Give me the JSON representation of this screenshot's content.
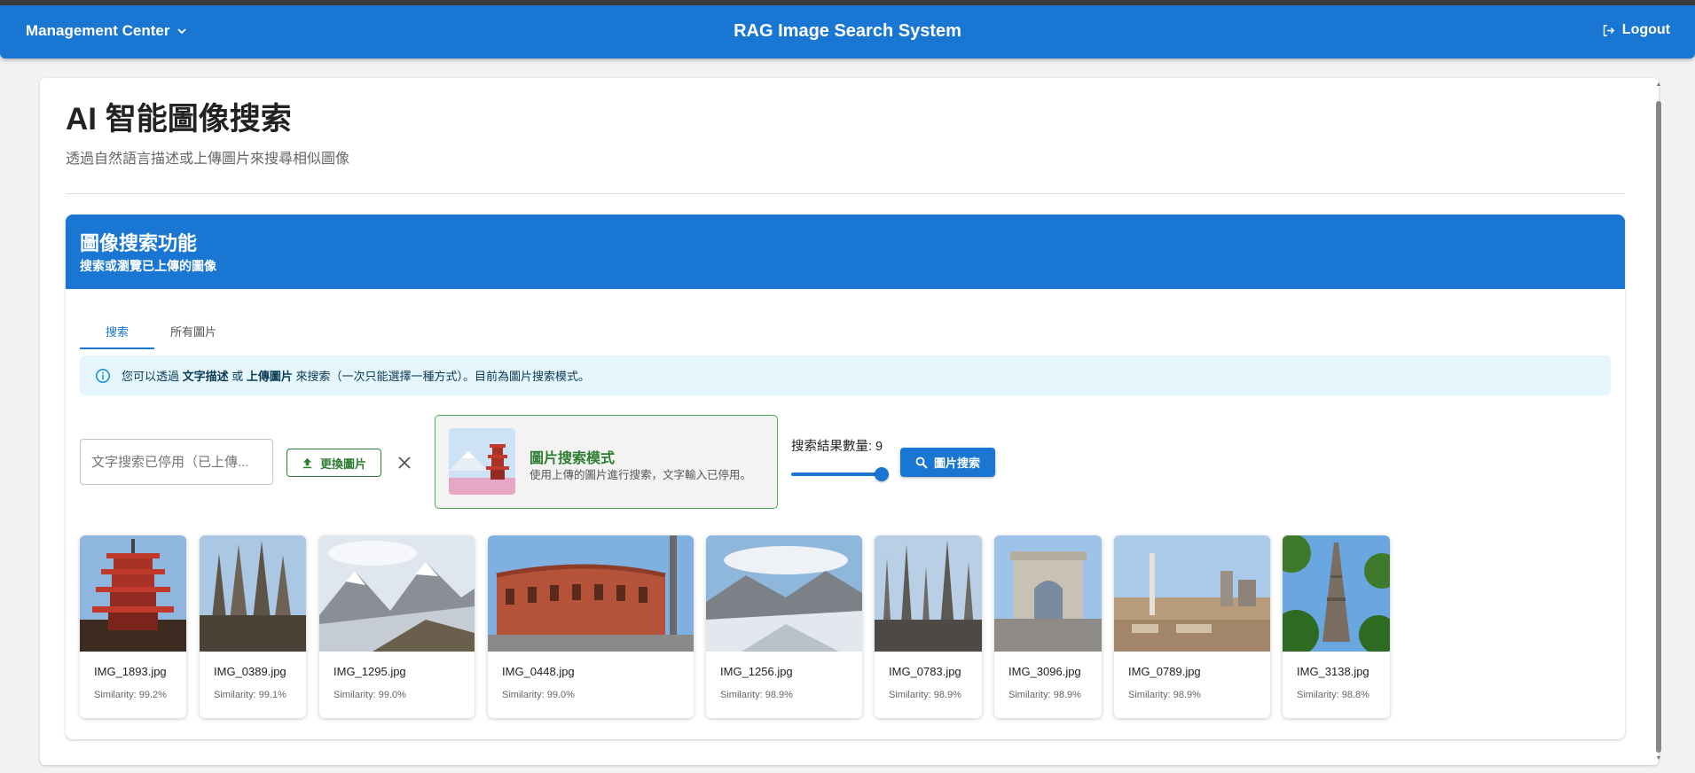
{
  "appbar": {
    "menu_label": "Management Center",
    "title": "RAG Image Search System",
    "logout_label": "Logout"
  },
  "page": {
    "title": "AI 智能圖像搜索",
    "subtitle": "透過自然語言描述或上傳圖片來搜尋相似圖像"
  },
  "panel": {
    "heading": "圖像搜索功能",
    "subheading": "搜索或瀏覽已上傳的圖像",
    "tabs": [
      {
        "label": "搜索",
        "active": true
      },
      {
        "label": "所有圖片",
        "active": false
      }
    ],
    "alert": {
      "prefix": "您可以透過 ",
      "strong1": "文字描述",
      "mid": " 或 ",
      "strong2": "上傳圖片",
      "suffix": " 來搜索（一次只能選擇一種方式）。目前為圖片搜索模式。"
    },
    "text_input_placeholder": "文字搜索已停用（已上傳...",
    "change_image_label": "更換圖片",
    "mode": {
      "title": "圖片搜索模式",
      "description": "使用上傳的圖片進行搜索，文字輸入已停用。"
    },
    "result_count_label": "搜索結果數量: 9",
    "result_count": 9,
    "search_button_label": "圖片搜索"
  },
  "results": [
    {
      "filename": "IMG_1893.jpg",
      "similarity": "Similarity: 99.2%",
      "icon": "pagoda-photo"
    },
    {
      "filename": "IMG_0389.jpg",
      "similarity": "Similarity: 99.1%",
      "icon": "cathedral-photo"
    },
    {
      "filename": "IMG_1295.jpg",
      "similarity": "Similarity: 99.0%",
      "icon": "mountain-photo"
    },
    {
      "filename": "IMG_0448.jpg",
      "similarity": "Similarity: 99.0%",
      "icon": "arena-photo"
    },
    {
      "filename": "IMG_1256.jpg",
      "similarity": "Similarity: 98.9%",
      "icon": "glacier-photo"
    },
    {
      "filename": "IMG_0783.jpg",
      "similarity": "Similarity: 98.9%",
      "icon": "gothic-spires-photo"
    },
    {
      "filename": "IMG_3096.jpg",
      "similarity": "Similarity: 98.9%",
      "icon": "triumphal-arch-photo"
    },
    {
      "filename": "IMG_0789.jpg",
      "similarity": "Similarity: 98.9%",
      "icon": "city-rooftop-photo"
    },
    {
      "filename": "IMG_3138.jpg",
      "similarity": "Similarity: 98.8%",
      "icon": "eiffel-tower-photo"
    }
  ],
  "colors": {
    "primary": "#1976d2",
    "success": "#2e7d32",
    "alert_bg": "#e5f6fd"
  }
}
